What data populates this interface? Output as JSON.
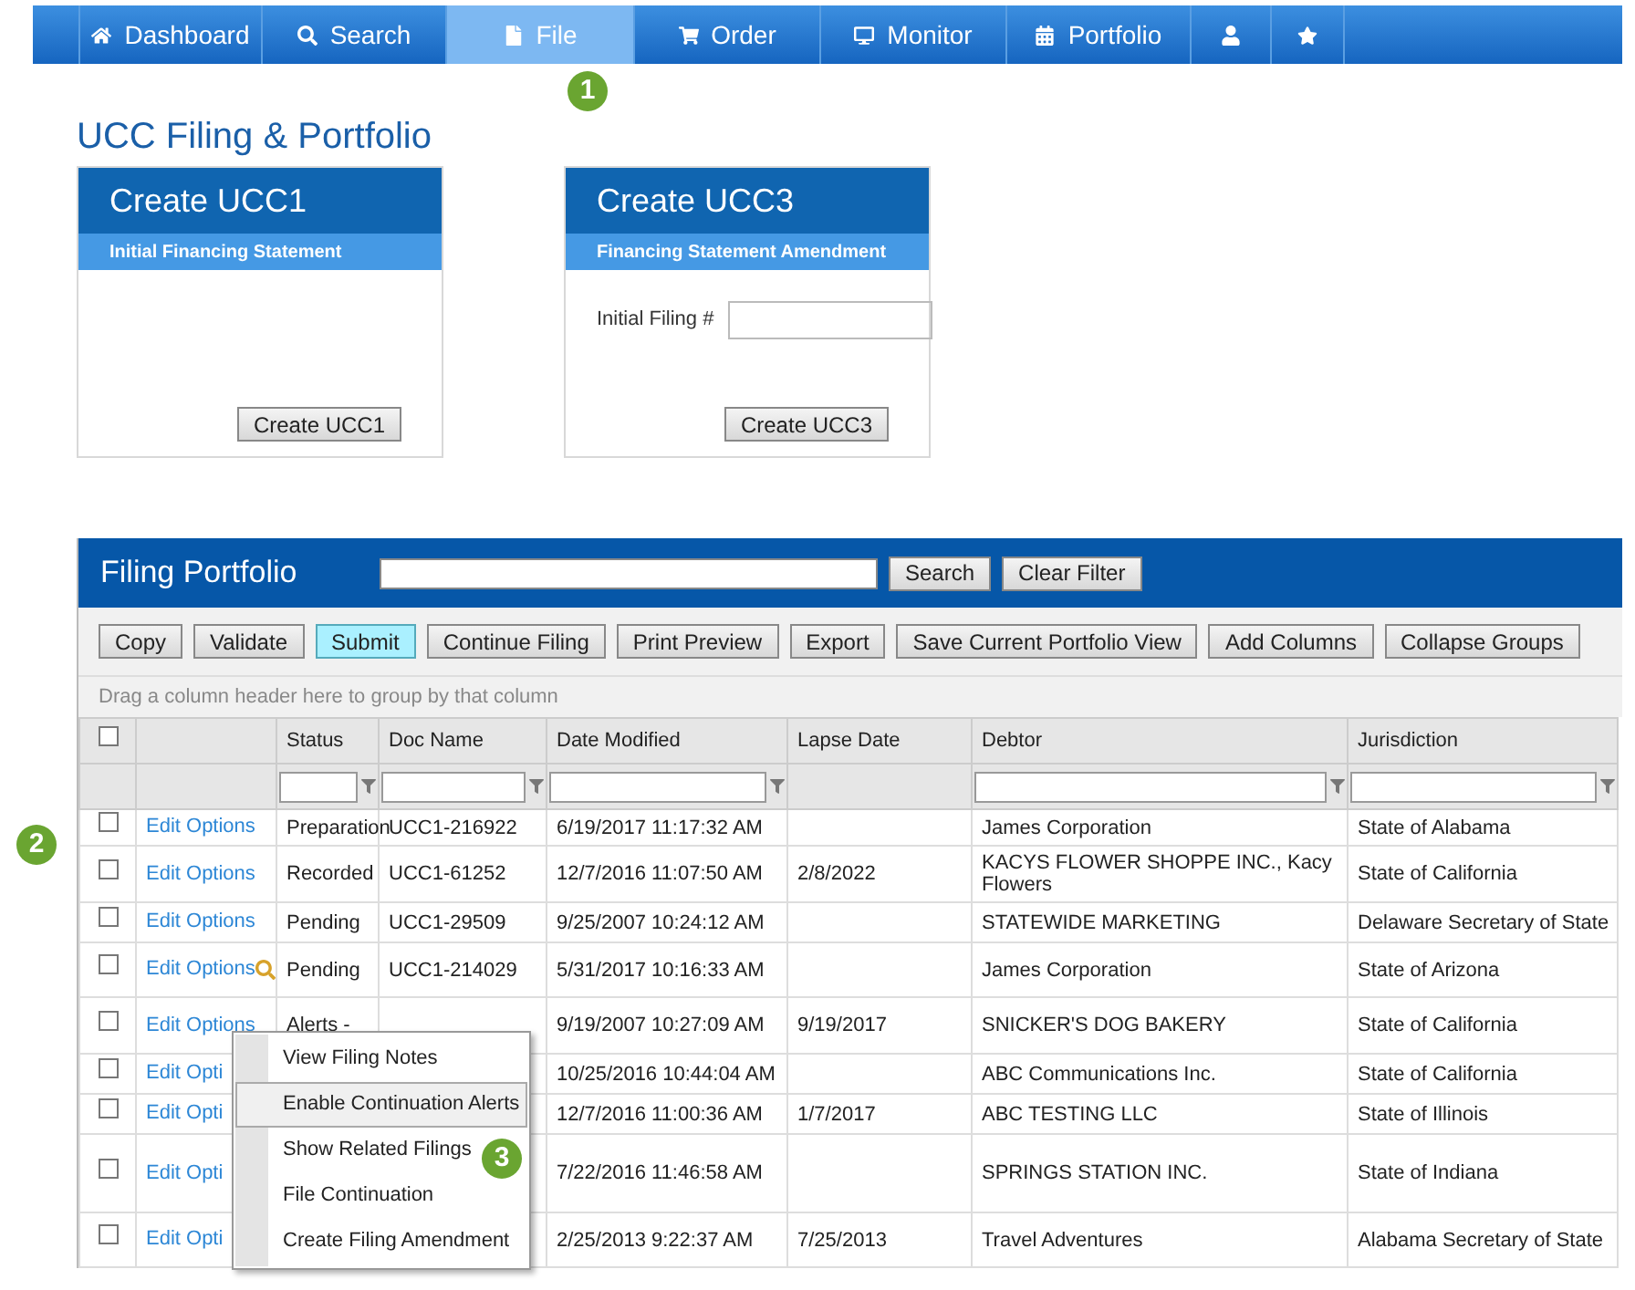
{
  "nav": [
    {
      "label": "Dashboard",
      "selected": false
    },
    {
      "label": "Search",
      "selected": false
    },
    {
      "label": "File",
      "selected": true
    },
    {
      "label": "Order",
      "selected": false
    },
    {
      "label": "Monitor",
      "selected": false
    },
    {
      "label": "Portfolio",
      "selected": false
    },
    {
      "selected": false
    },
    {
      "selected": false
    }
  ],
  "callouts": [
    "1",
    "2",
    "3"
  ],
  "page_title": "UCC Filing & Portfolio",
  "cards": [
    {
      "title": "Create UCC1",
      "subtitle": "Initial Financing Statement",
      "button": "Create UCC1"
    },
    {
      "title": "Create UCC3",
      "subtitle": "Financing Statement Amendment",
      "field_label": "Initial Filing #",
      "button": "Create UCC3"
    }
  ],
  "portfolio": {
    "title": "Filing Portfolio",
    "search_button": "Search",
    "clear_button": "Clear Filter",
    "toolbar": [
      {
        "label": "Copy",
        "active": false
      },
      {
        "label": "Validate",
        "active": false
      },
      {
        "label": "Submit",
        "active": true
      },
      {
        "label": "Continue Filing",
        "active": false
      },
      {
        "label": "Print Preview",
        "active": false
      },
      {
        "label": "Export",
        "active": false
      },
      {
        "label": "Save Current Portfolio View",
        "active": false
      },
      {
        "label": "Add Columns",
        "active": false
      },
      {
        "label": "Collapse Groups",
        "active": false
      }
    ],
    "group_hint": "Drag a column header here to group by that column",
    "select_all_checked": false,
    "columns": [
      {
        "label": "Status",
        "filter": true
      },
      {
        "label": "Doc Name",
        "filter": true
      },
      {
        "label": "Date Modified",
        "filter": true
      },
      {
        "label": "Lapse Date",
        "filter": false
      },
      {
        "label": "Debtor",
        "filter": true
      },
      {
        "label": "Jurisdiction",
        "filter": true
      }
    ],
    "rows": [
      {
        "checked": false,
        "edit": "Edit Options",
        "status": "Preparation",
        "doc_name": "UCC1-216922",
        "date_modified": "6/19/2017 11:17:32 AM",
        "debtor": "James Corporation",
        "jurisdiction": "State of Alabama"
      },
      {
        "checked": false,
        "edit": "Edit Options",
        "status": "Recorded",
        "doc_name": "UCC1-61252",
        "date_modified": "12/7/2016 11:07:50 AM",
        "lapse_date": "2/8/2022",
        "debtor": "KACYS FLOWER SHOPPE INC., Kacy Flowers",
        "jurisdiction": "State of California"
      },
      {
        "checked": false,
        "edit": "Edit Options",
        "status": "Pending",
        "doc_name": "UCC1-29509",
        "date_modified": "9/25/2007 10:24:12 AM",
        "debtor": "STATEWIDE MARKETING",
        "jurisdiction": "Delaware Secretary of State"
      },
      {
        "checked": false,
        "edit": "Edit Options",
        "hover": true,
        "status": "Pending",
        "doc_name": "UCC1-214029",
        "date_modified": "5/31/2017 10:16:33 AM",
        "debtor": "James Corporation",
        "jurisdiction": "State of Arizona"
      },
      {
        "checked": false,
        "edit": "Edit Options",
        "status": "Alerts -",
        "date_modified": "9/19/2007 10:27:09 AM",
        "lapse_date": "9/19/2017",
        "debtor": "SNICKER'S DOG BAKERY",
        "jurisdiction": "State of California"
      },
      {
        "checked": false,
        "edit": "Edit Opti",
        "date_modified": "10/25/2016 10:44:04 AM",
        "debtor": "ABC Communications Inc.",
        "jurisdiction": "State of California"
      },
      {
        "checked": false,
        "edit": "Edit Opti",
        "date_modified": "12/7/2016 11:00:36 AM",
        "lapse_date": "1/7/2017",
        "debtor": "ABC TESTING LLC",
        "jurisdiction": "State of Illinois"
      },
      {
        "checked": false,
        "edit": "Edit Opti",
        "date_modified": "7/22/2016 11:46:58 AM",
        "debtor": "SPRINGS STATION INC.",
        "jurisdiction": "State of Indiana"
      },
      {
        "checked": false,
        "edit": "Edit Opti",
        "date_modified": "2/25/2013 9:22:37 AM",
        "lapse_date": "7/25/2013",
        "debtor": "Travel Adventures",
        "jurisdiction": "Alabama Secretary of State"
      }
    ]
  },
  "context_menu": [
    {
      "label": "View Filing Notes",
      "selected": false
    },
    {
      "label": "Enable Continuation Alerts",
      "selected": true
    },
    {
      "label": "Show Related Filings",
      "selected": false
    },
    {
      "label": "File Continuation",
      "selected": false
    },
    {
      "label": "Create Filing Amendment",
      "selected": false
    }
  ]
}
